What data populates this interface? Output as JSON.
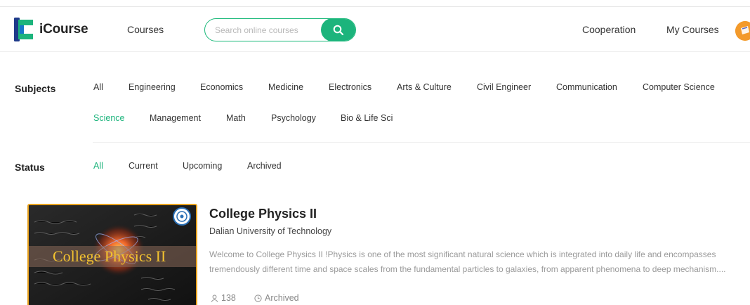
{
  "brand": {
    "name": "iCourse",
    "color": "#1cb47c"
  },
  "header": {
    "courses_label": "Courses",
    "search_placeholder": "Search online courses",
    "search_icon": "search-icon",
    "cooperation_label": "Cooperation",
    "my_courses_label": "My Courses"
  },
  "filters": {
    "subjects_label": "Subjects",
    "subjects": [
      "All",
      "Engineering",
      "Economics",
      "Medicine",
      "Electronics",
      "Arts & Culture",
      "Civil Engineer",
      "Communication",
      "Computer Science",
      "Science",
      "Management",
      "Math",
      "Psychology",
      "Bio & Life Sci"
    ],
    "subject_selected": "Science",
    "status_label": "Status",
    "statuses": [
      "All",
      "Current",
      "Upcoming",
      "Archived"
    ],
    "status_selected": "All"
  },
  "course": {
    "thumbnail_text": "College Physics II",
    "title": "College Physics II",
    "university": "Dalian University of Technology",
    "description_line1": "Welcome to College Physics II !Physics is one of the most significant natural science which is integrated into daily life and encompasses",
    "description_line2": "tremendously different time and space scales from the fundamental particles to galaxies, from apparent phenomena to deep mechanism....",
    "enrolled": "138",
    "status": "Archived"
  },
  "colors": {
    "accent": "#1cb47c",
    "thumb_border": "#e8a21d",
    "avatar": "#f39a2b"
  }
}
